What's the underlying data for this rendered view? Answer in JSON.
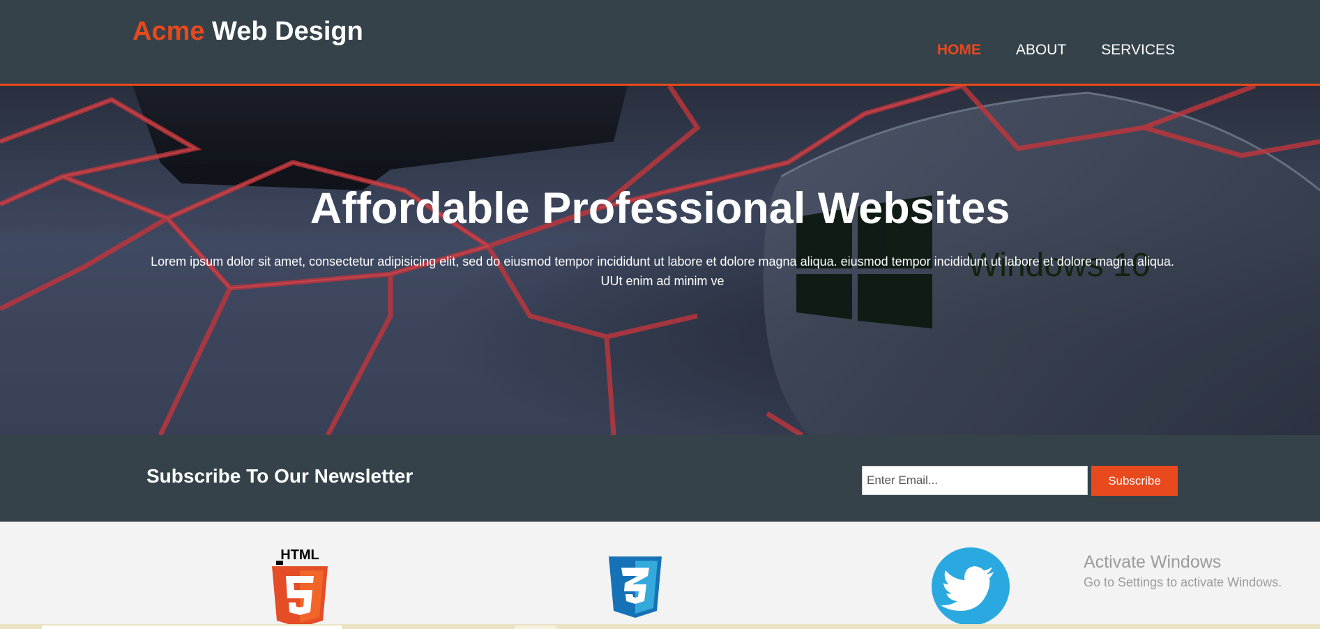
{
  "header": {
    "brand_highlight": "Acme",
    "brand_rest": " Web Design",
    "nav": [
      {
        "label": "HOME",
        "current": true
      },
      {
        "label": "ABOUT",
        "current": false
      },
      {
        "label": "SERVICES",
        "current": false
      }
    ]
  },
  "showcase": {
    "title": "Affordable Professional Websites",
    "text": "Lorem ipsum dolor sit amet, consectetur adipisicing elit, sed do eiusmod tempor incididunt ut labore et dolore magna aliqua. eiusmod tempor incididunt ut labore et dolore magna aliqua. UUt enim ad minim ve",
    "background_text": "Windows 10"
  },
  "newsletter": {
    "title": "Subscribe To Our Newsletter",
    "email_placeholder": "Enter Email...",
    "button_label": "Subscribe"
  },
  "boxes": {
    "icons": [
      "html5-icon",
      "css3-icon",
      "twitter-icon"
    ],
    "html5_label": "HTML"
  },
  "overlay": {
    "activate_title": "Activate Windows",
    "activate_subtitle": "Go to Settings to activate Windows."
  },
  "colors": {
    "accent": "#e8491d",
    "dark": "#35424a",
    "html5": "#e44d26",
    "css3": "#1572b6",
    "twitter": "#2aa9e0"
  }
}
